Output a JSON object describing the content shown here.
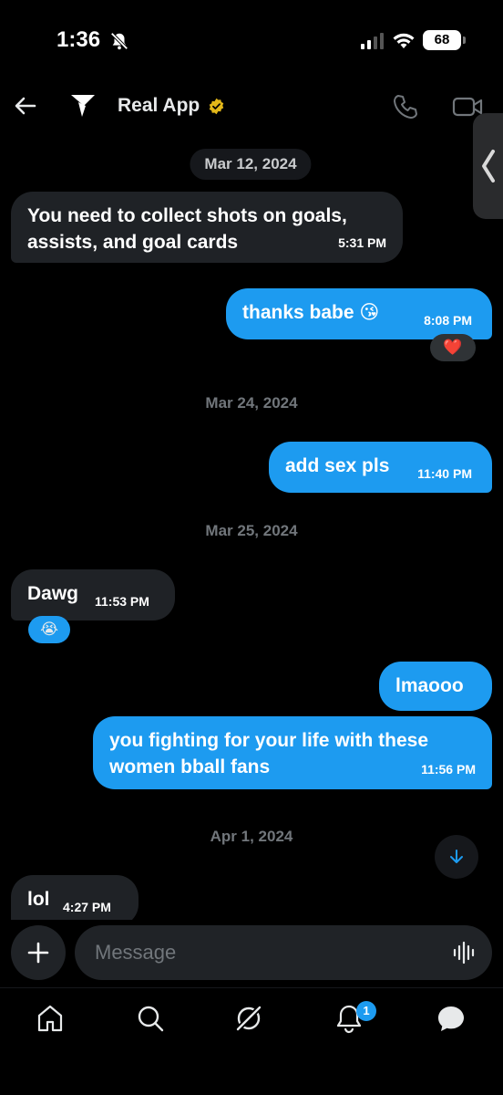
{
  "status_bar": {
    "time": "1:36",
    "battery": "68"
  },
  "header": {
    "title": "Real App"
  },
  "dates": [
    "Mar 12, 2024",
    "Mar 24, 2024",
    "Mar 25, 2024",
    "Apr 1, 2024"
  ],
  "messages": [
    {
      "text": "You need to collect shots on goals, assists, and goal cards",
      "time": "5:31 PM"
    },
    {
      "text": "thanks babe 😘",
      "time": "8:08 PM",
      "reaction": "❤️"
    },
    {
      "text": "add sex pls",
      "time": "11:40 PM"
    },
    {
      "text": "Dawg",
      "time": "11:53 PM",
      "reaction": "😭"
    },
    {
      "text": "lmaooo"
    },
    {
      "text": "you fighting for your life with these women bball fans",
      "time": "11:56 PM"
    },
    {
      "text": "lol",
      "time": "4:27 PM"
    }
  ],
  "composer": {
    "placeholder": "Message"
  },
  "tabbar": {
    "notification_count": "1"
  },
  "colors": {
    "accent": "#1d9bf0",
    "incoming": "#1f2226",
    "background": "#000000",
    "verified": "#e2b719"
  }
}
